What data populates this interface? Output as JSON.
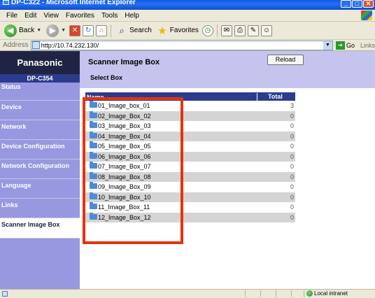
{
  "window": {
    "title": "DP-C322 - Microsoft Internet Explorer"
  },
  "menu": {
    "items": [
      "File",
      "Edit",
      "View",
      "Favorites",
      "Tools",
      "Help"
    ]
  },
  "toolbar": {
    "back_label": "Back",
    "search_label": "Search",
    "favorites_label": "Favorites"
  },
  "address": {
    "label": "Address",
    "url": "http://10.74.232.130/",
    "go_label": "Go",
    "links_label": "Links"
  },
  "sidebar": {
    "brand": "Panasonic",
    "model": "DP-C354",
    "items": [
      "Status",
      "Device",
      "Network",
      "Device Configuration",
      "Network Configuration",
      "Language",
      "Links",
      "Scanner Image Box"
    ],
    "active_index": 7
  },
  "main": {
    "title": "Scanner Image Box",
    "subtitle": "Select Box",
    "reload_label": "Reload",
    "table": {
      "headers": [
        "Name",
        "Total"
      ],
      "rows": [
        {
          "name": "01_Image_box_01",
          "total": "3"
        },
        {
          "name": "02_Image_Box_02",
          "total": "0"
        },
        {
          "name": "03_Image_Box_03",
          "total": "0"
        },
        {
          "name": "04_Image_Box_04",
          "total": "0"
        },
        {
          "name": "05_Image_Box_05",
          "total": "0"
        },
        {
          "name": "06_Image_Box_06",
          "total": "0"
        },
        {
          "name": "07_Image_Box_07",
          "total": "0"
        },
        {
          "name": "08_Image_Box_08",
          "total": "0"
        },
        {
          "name": "09_Image_Box_09",
          "total": "0"
        },
        {
          "name": "10_Image_Box_10",
          "total": "0"
        },
        {
          "name": "11_Image_Box_11",
          "total": "0"
        },
        {
          "name": "12_Image_Box_12",
          "total": "0"
        }
      ]
    }
  },
  "status": {
    "zone_label": "Local intranet"
  },
  "colors": {
    "sidebar": "#9898e0",
    "header_band": "#c4c4ee",
    "table_header": "#2c3c8c",
    "brand_bg": "#202444",
    "highlight": "#e8320e"
  }
}
